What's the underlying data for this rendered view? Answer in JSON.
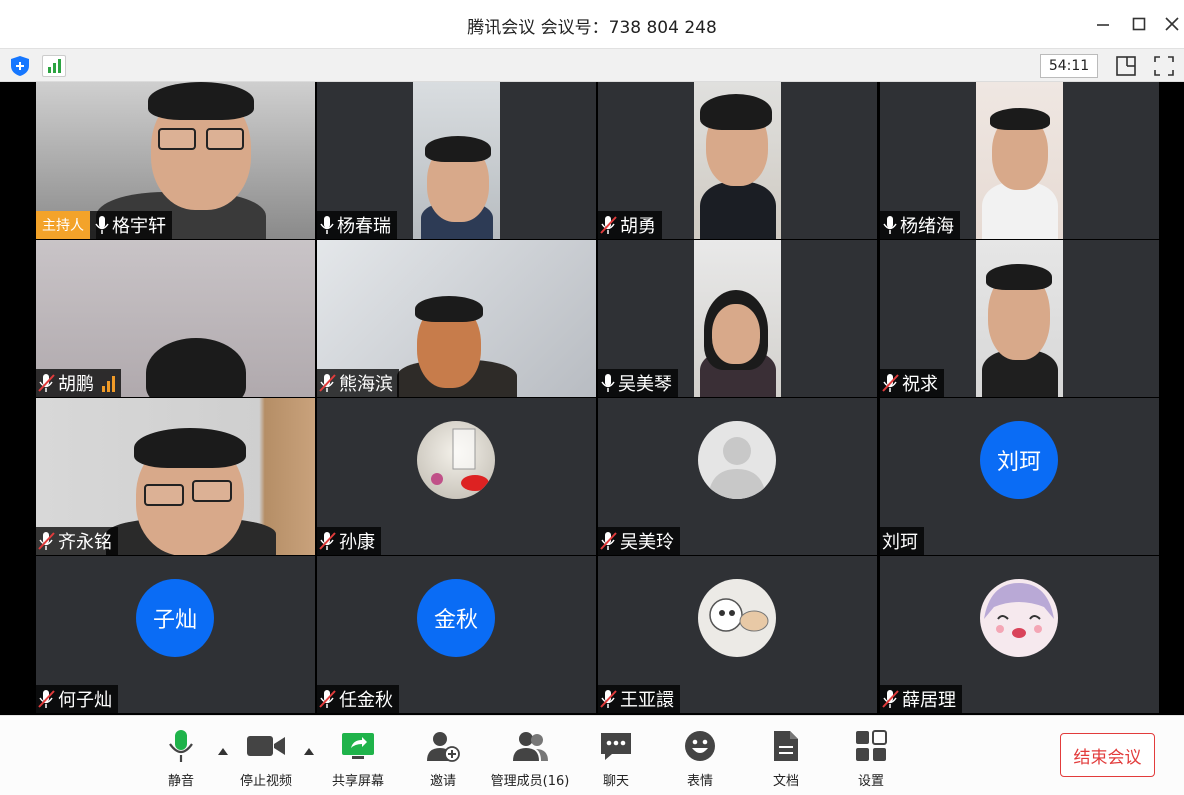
{
  "window": {
    "title": "腾讯会议 会议号：738 804 248",
    "timer": "54:11"
  },
  "participants": [
    {
      "name": "格宇轩",
      "host_badge": "主持人",
      "mic": "on"
    },
    {
      "name": "杨春瑞",
      "mic": "on"
    },
    {
      "name": "胡勇",
      "mic": "muted"
    },
    {
      "name": "杨绪海",
      "mic": "on"
    },
    {
      "name": "胡鹏",
      "mic": "muted",
      "speaking": true
    },
    {
      "name": "熊海滨",
      "mic": "muted"
    },
    {
      "name": "吴美琴",
      "mic": "on"
    },
    {
      "name": "祝求",
      "mic": "muted"
    },
    {
      "name": "齐永铭",
      "mic": "muted"
    },
    {
      "name": "孙康",
      "mic": "muted"
    },
    {
      "name": "吴美玲",
      "mic": "muted"
    },
    {
      "name": "刘珂",
      "avatar_text": "刘珂",
      "mic": "none"
    },
    {
      "name": "何子灿",
      "avatar_text": "子灿",
      "mic": "muted"
    },
    {
      "name": "任金秋",
      "avatar_text": "金秋",
      "mic": "muted"
    },
    {
      "name": "王亚譞",
      "mic": "muted"
    },
    {
      "name": "薛居理",
      "mic": "muted"
    }
  ],
  "controls": {
    "mute": "静音",
    "stop_video": "停止视频",
    "share_screen": "共享屏幕",
    "invite": "邀请",
    "manage_members": "管理成员(16)",
    "chat": "聊天",
    "reactions": "表情",
    "docs": "文档",
    "settings": "设置",
    "end_meeting": "结束会议"
  },
  "colors": {
    "accent_blue": "#0a6cf5",
    "host_badge": "#f3a32a",
    "end_red": "#e23c3c",
    "signal_green": "#2ba341",
    "tile_bg": "#2f3135"
  }
}
